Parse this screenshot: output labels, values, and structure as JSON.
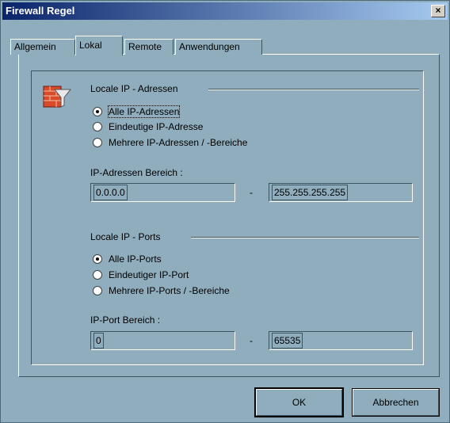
{
  "window": {
    "title": "Firewall Regel",
    "close_label": "×"
  },
  "tabs": [
    {
      "label": "Allgemein"
    },
    {
      "label": "Lokal"
    },
    {
      "label": "Remote"
    },
    {
      "label": "Anwendungen"
    }
  ],
  "ip_section": {
    "title": "Locale IP - Adressen",
    "options": [
      {
        "label": "Alle IP-Adressen",
        "checked": true
      },
      {
        "label": "Eindeutige IP-Adresse",
        "checked": false
      },
      {
        "label": "Mehrere IP-Adressen / -Bereiche",
        "checked": false
      }
    ],
    "range_label": "IP-Adressen Bereich :",
    "from_value": "0.0.0.0",
    "separator": "-",
    "to_value": "255.255.255.255"
  },
  "port_section": {
    "title": "Locale IP - Ports",
    "options": [
      {
        "label": "Alle IP-Ports",
        "checked": true
      },
      {
        "label": "Eindeutiger IP-Port",
        "checked": false
      },
      {
        "label": "Mehrere IP-Ports / -Bereiche",
        "checked": false
      }
    ],
    "range_label": "IP-Port Bereich :",
    "from_value": "0",
    "separator": "-",
    "to_value": "65535"
  },
  "buttons": {
    "ok": "OK",
    "cancel": "Abbrechen"
  },
  "icon": "firewall-filter-icon"
}
